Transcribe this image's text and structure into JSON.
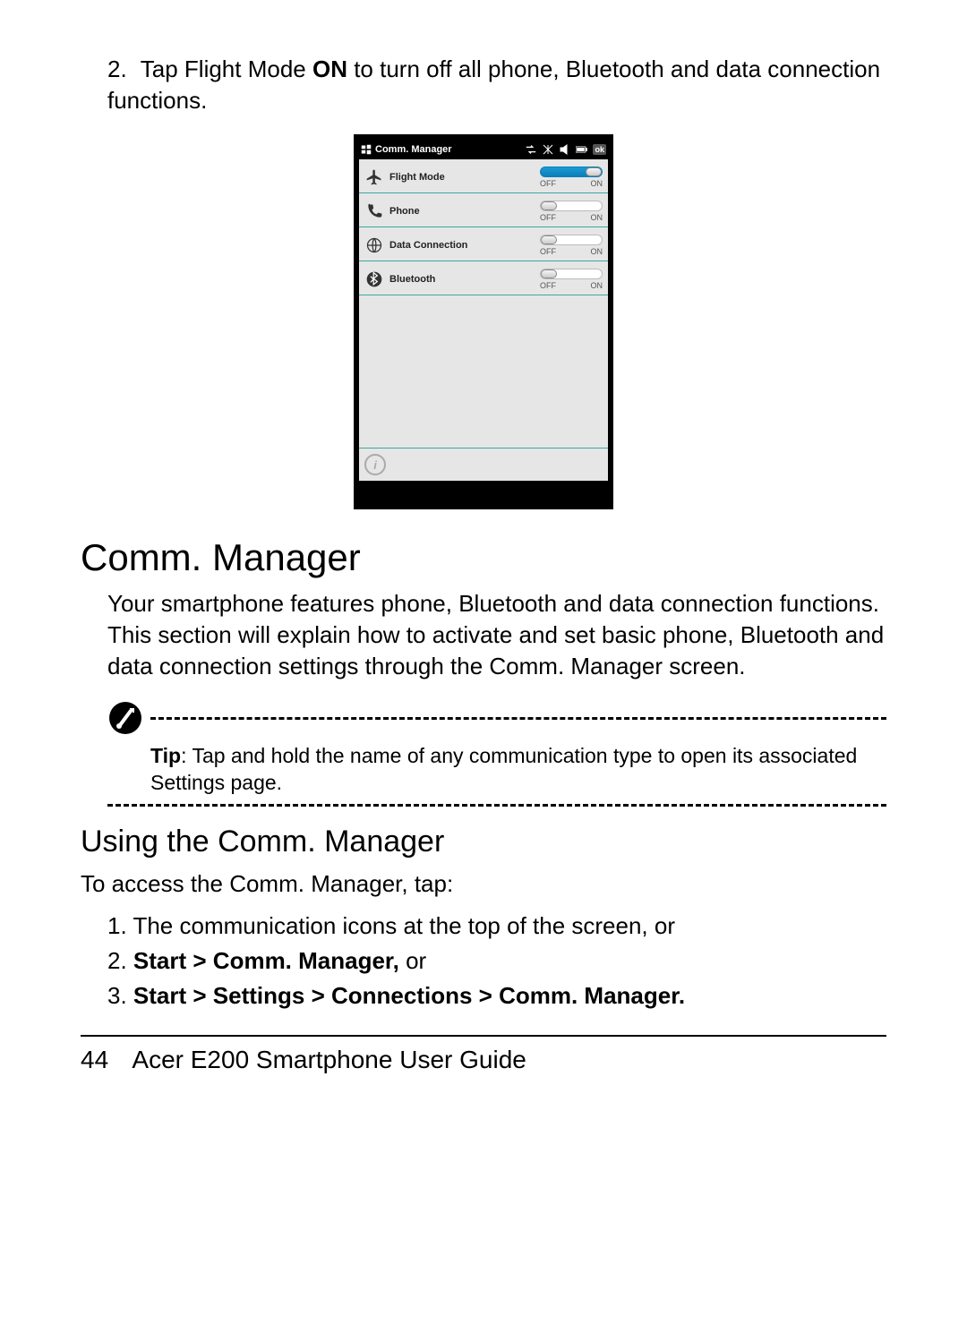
{
  "step": {
    "number": "2.",
    "text_before_bold": "Tap Flight Mode ",
    "bold": "ON",
    "text_after_bold": " to turn off all phone, Bluetooth and data connection functions."
  },
  "screenshot": {
    "title": "Comm. Manager",
    "ok": "ok",
    "rows": [
      {
        "label": "Flight Mode",
        "state": "on",
        "off": "OFF",
        "on": "ON"
      },
      {
        "label": "Phone",
        "state": "off",
        "off": "OFF",
        "on": "ON"
      },
      {
        "label": "Data Connection",
        "state": "off",
        "off": "OFF",
        "on": "ON"
      },
      {
        "label": "Bluetooth",
        "state": "off",
        "off": "OFF",
        "on": "ON"
      }
    ]
  },
  "section_heading": "Comm. Manager",
  "section_para": "Your smartphone features phone, Bluetooth and data connec­tion functions. This section will explain how to activate and set basic phone, Bluetooth and data connection settings through the Comm. Manager screen.",
  "tip": {
    "label": "Tip",
    "text": ": Tap and hold the name of any communication type to open its associated Settings page."
  },
  "sub_heading": "Using the Comm. Manager",
  "sub_para": "To access the Comm. Manager, tap:",
  "list": [
    {
      "num": "1.",
      "plain": "The communication icons at the top of the screen, or"
    },
    {
      "num": "2.",
      "bold": "Start > Comm. Manager,",
      "plain2": " or"
    },
    {
      "num": "3.",
      "bold": "Start > Settings > Connections > Comm. Manager."
    }
  ],
  "footer": {
    "page": "44",
    "title": "Acer E200 Smartphone User Guide"
  }
}
